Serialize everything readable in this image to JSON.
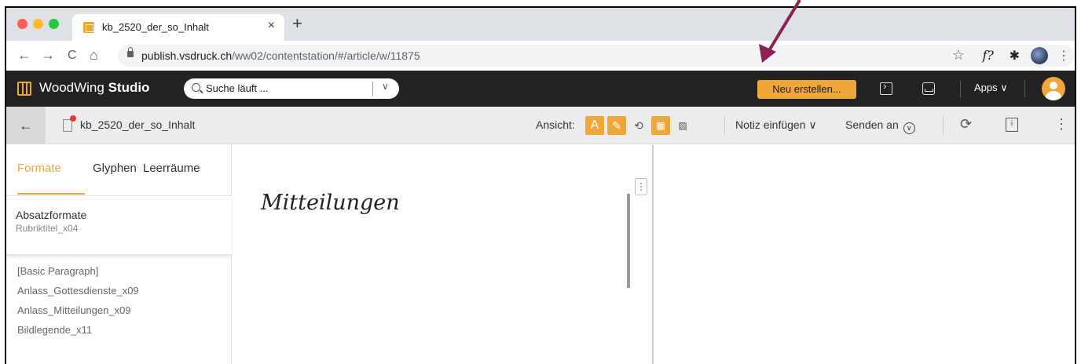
{
  "browser": {
    "tab_title": "kb_2520_der_so_Inhalt",
    "tab_close": "×",
    "new_tab": "+",
    "url_host": "publish.vsdruck.ch",
    "url_path": "/ww02/contentstation/#/article/w/11875",
    "nav": {
      "back": "←",
      "forward": "→",
      "reload": "C",
      "home": "⌂"
    },
    "bookmark_star": "☆",
    "ext_label": "f?",
    "puzzle": "✱",
    "menu": "⋮"
  },
  "app": {
    "brand_light": "WoodWing ",
    "brand_bold": "Studio",
    "search_text": "Suche läuft ...",
    "search_chevron": "∨",
    "new_button": "Neu erstellen...",
    "apps_label": "Apps ∨",
    "accent": "#f0a73a"
  },
  "article": {
    "back": "←",
    "title": "kb_2520_der_so_Inhalt",
    "view_label": "Ansicht:",
    "view_buttons": [
      "A",
      "✎",
      "⟲",
      "▦",
      "▨"
    ],
    "notiz": "Notiz einfügen ∨",
    "senden": "Senden an",
    "senden_icon": "∨",
    "refresh": "⟳",
    "pdf_label": "⤓",
    "more": "⋮"
  },
  "panel": {
    "tabs": [
      "Formate",
      "Glyphen",
      "Leerräume"
    ],
    "section_title": "Absatzformate",
    "section_sub": "Rubriktitel_x04",
    "styles": [
      "[Basic Paragraph]",
      "Anlass_Gottesdienste_x09",
      "Anlass_Mitteilungen_x09",
      "Bildlegende_x11"
    ]
  },
  "editor": {
    "heading": "Mitteilungen",
    "menu": "⋮"
  }
}
